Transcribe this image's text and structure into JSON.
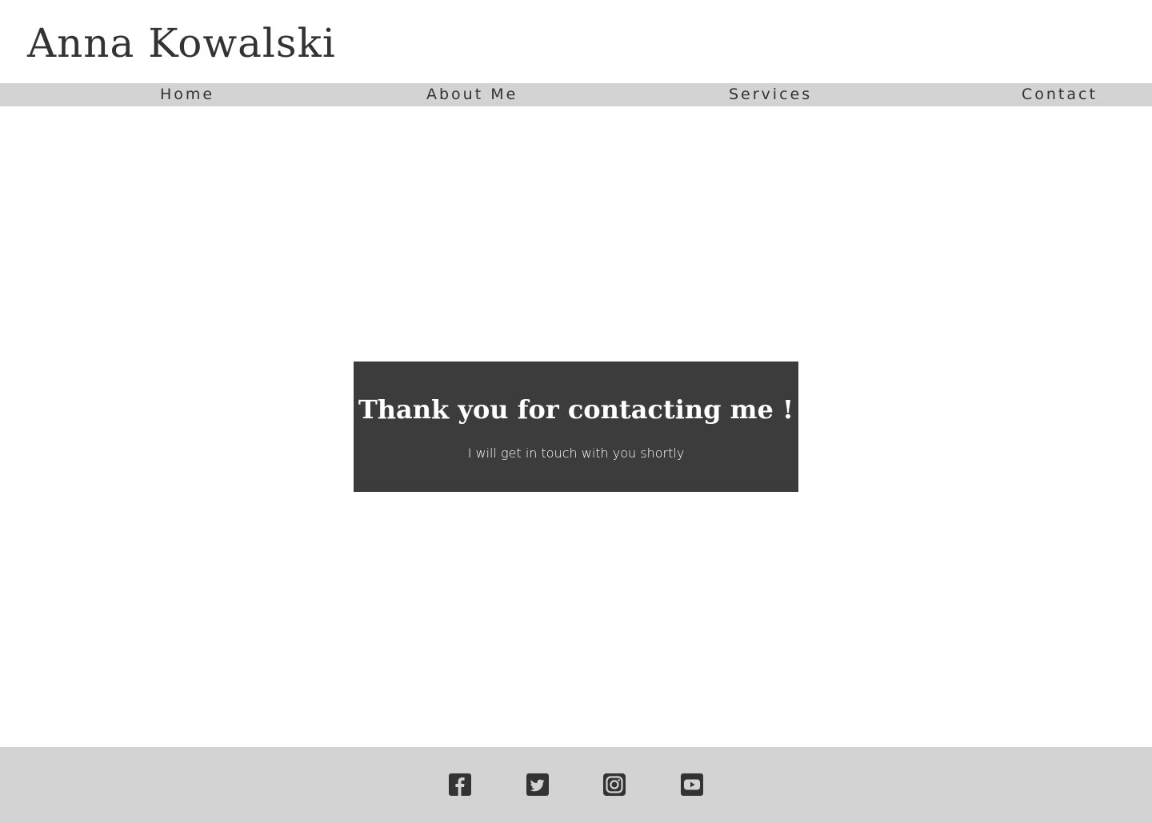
{
  "header": {
    "title": "Anna Kowalski"
  },
  "nav": {
    "items": [
      {
        "label": "Home"
      },
      {
        "label": "About Me"
      },
      {
        "label": "Services"
      },
      {
        "label": "Contact"
      }
    ]
  },
  "confirmation": {
    "heading": "Thank you for contacting me !",
    "message": "I will get in touch with you shortly"
  },
  "footer": {
    "social_links": [
      {
        "icon": "facebook-square-icon"
      },
      {
        "icon": "twitter-square-icon"
      },
      {
        "icon": "instagram-icon"
      },
      {
        "icon": "youtube-square-icon"
      }
    ]
  },
  "colors": {
    "nav_background": "#d3d3d3",
    "footer_background": "#d3d3d3",
    "card_background": "#3c3c3c",
    "text_dark": "#333333",
    "text_light": "#ffffff"
  }
}
